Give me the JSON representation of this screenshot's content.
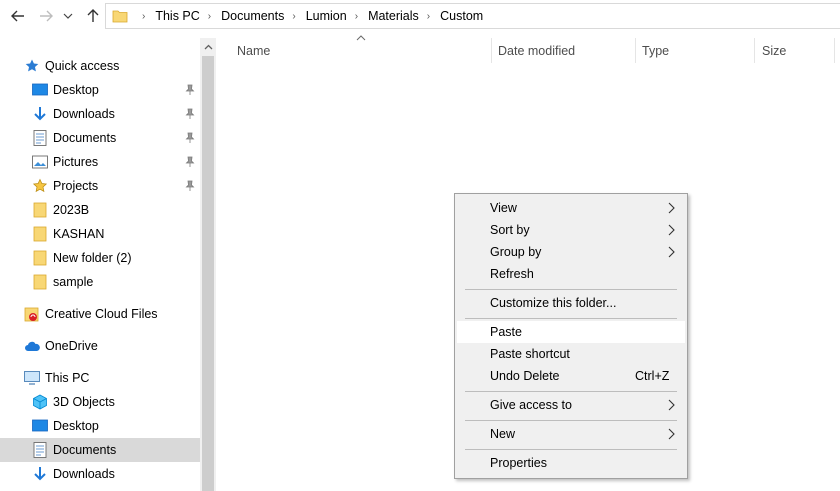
{
  "breadcrumb": [
    "This PC",
    "Documents",
    "Lumion",
    "Materials",
    "Custom"
  ],
  "nav": {
    "items": [
      {
        "label": "Quick access"
      },
      {
        "label": "Desktop"
      },
      {
        "label": "Downloads"
      },
      {
        "label": "Documents"
      },
      {
        "label": "Pictures"
      },
      {
        "label": "Projects"
      },
      {
        "label": "2023B"
      },
      {
        "label": "KASHAN"
      },
      {
        "label": "New folder (2)"
      },
      {
        "label": "sample"
      },
      {
        "label": "Creative Cloud Files"
      },
      {
        "label": "OneDrive"
      },
      {
        "label": "This PC"
      },
      {
        "label": "3D Objects"
      },
      {
        "label": "Desktop"
      },
      {
        "label": "Documents"
      },
      {
        "label": "Downloads"
      }
    ]
  },
  "columns": {
    "name": "Name",
    "date_modified": "Date modified",
    "type": "Type",
    "size": "Size"
  },
  "context_menu": {
    "view": "View",
    "sort_by": "Sort by",
    "group_by": "Group by",
    "refresh": "Refresh",
    "customize": "Customize this folder...",
    "paste": "Paste",
    "paste_shortcut": "Paste shortcut",
    "undo_delete": "Undo Delete",
    "undo_delete_shortcut": "Ctrl+Z",
    "give_access": "Give access to",
    "new": "New",
    "properties": "Properties"
  },
  "colors": {
    "selected_bg": "#d9d9d9",
    "menu_bg": "#f0f0f0",
    "folder_yellow": "#f8d775",
    "accent_blue": "#1e78d7"
  }
}
